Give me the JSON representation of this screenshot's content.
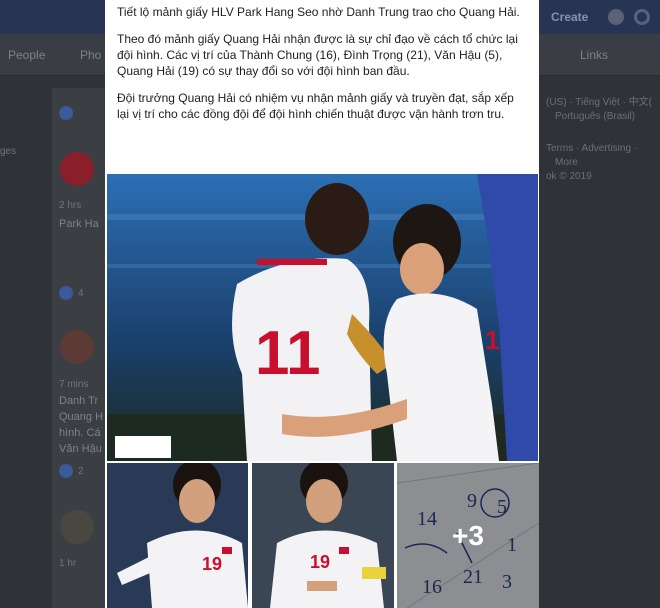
{
  "background": {
    "topbar": {
      "create_label": "Create"
    },
    "tabs": [
      "People",
      "Pho",
      "Links"
    ],
    "feed": [
      {
        "time": "2 hrs",
        "author": "Park Ha",
        "likes": "4"
      },
      {
        "time": "7 mins",
        "lines": [
          "Danh Tr",
          "Quang H",
          "hình. Cá",
          "Văn Hậu"
        ],
        "likes": "2"
      },
      {
        "time": "1 hr"
      }
    ],
    "left_label": "ges",
    "right_sidebar": {
      "languages_line1": "(US) · Tiếng Việt · 中文(",
      "languages_line2": "Português (Brasil)",
      "footer_line1": "Terms · Advertising ·",
      "footer_line2": "More",
      "copyright": "ok © 2019"
    }
  },
  "post": {
    "paragraphs": [
      "Tiết lộ mảnh giấy HLV Park Hang Seo nhờ Danh Trung trao cho Quang Hải.",
      "Theo đó mảnh giấy Quang Hải nhận được là sự chỉ đạo về cách tổ chức lại đội hình. Các vị trí của Thành Chung (16), Đình Trọng (21), Văn Hậu (5), Quang Hải (19) có sự thay đổi so với đội hình ban đầu.",
      "Đội trưởng Quang Hải có nhiệm vụ nhận mảnh giấy và truyền đạt, sắp xếp lại vị trí cho các đồng đội để đội hình chiến thuật được vận hành trơn tru."
    ],
    "photos": {
      "main_jersey_left": "11",
      "main_jersey_right": "1",
      "small_1_jersey": "19",
      "small_2_jersey": "19",
      "more_count": "+3",
      "note_numbers": [
        "14",
        "9",
        "5",
        "1",
        "16",
        "21",
        "3"
      ]
    }
  },
  "colors": {
    "card": "#ffffff",
    "topbar": "#283453",
    "jersey_red": "#c8102e",
    "text": "#1c1e21"
  }
}
